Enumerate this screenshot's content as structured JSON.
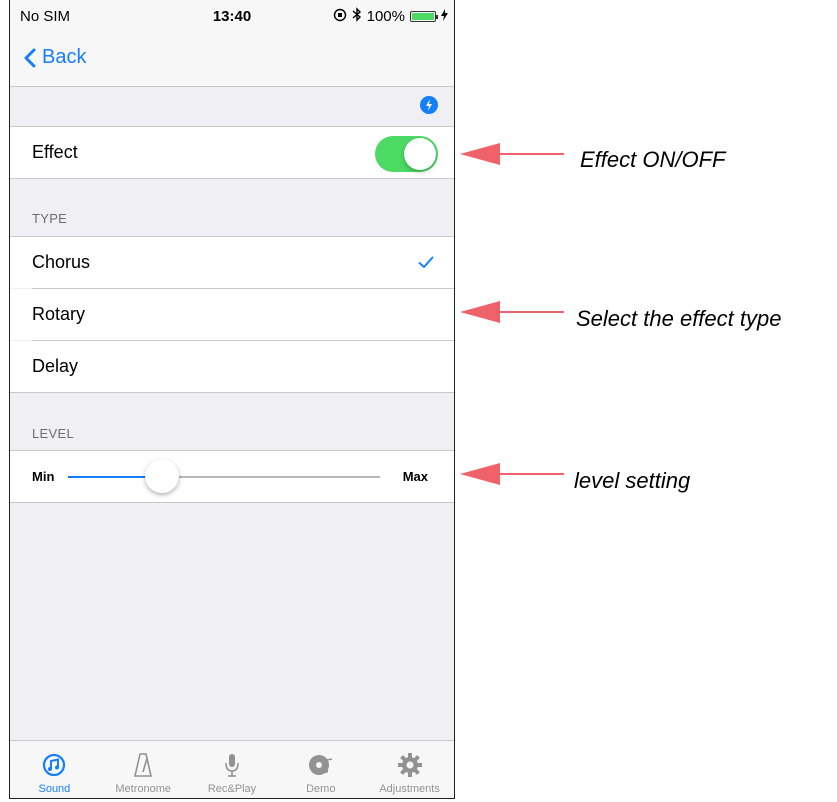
{
  "status": {
    "carrier": "No SIM",
    "time": "13:40",
    "battery": "100%",
    "battery_level": 1.0
  },
  "nav": {
    "back_label": "Back"
  },
  "effect": {
    "label": "Effect",
    "on": true
  },
  "type_section": {
    "header": "TYPE",
    "options": [
      {
        "label": "Chorus",
        "selected": true
      },
      {
        "label": "Rotary",
        "selected": false
      },
      {
        "label": "Delay",
        "selected": false
      }
    ]
  },
  "level_section": {
    "header": "LEVEL",
    "min_label": "Min",
    "max_label": "Max",
    "value": 0.3
  },
  "tabs": [
    {
      "label": "Sound",
      "icon": "sound-icon",
      "active": true
    },
    {
      "label": "Metronome",
      "icon": "metronome-icon",
      "active": false
    },
    {
      "label": "Rec&Play",
      "icon": "microphone-icon",
      "active": false
    },
    {
      "label": "Demo",
      "icon": "demo-disc-icon",
      "active": false
    },
    {
      "label": "Adjustments",
      "icon": "gear-icon",
      "active": false
    }
  ],
  "annotations": [
    {
      "text": "Effect ON/OFF"
    },
    {
      "text": "Select the effect type"
    },
    {
      "text": "level setting"
    }
  ],
  "colors": {
    "accent": "#157efb",
    "toggle_on": "#4cd964",
    "callout_arrow": "#f0626a",
    "background": "#efeff4"
  }
}
